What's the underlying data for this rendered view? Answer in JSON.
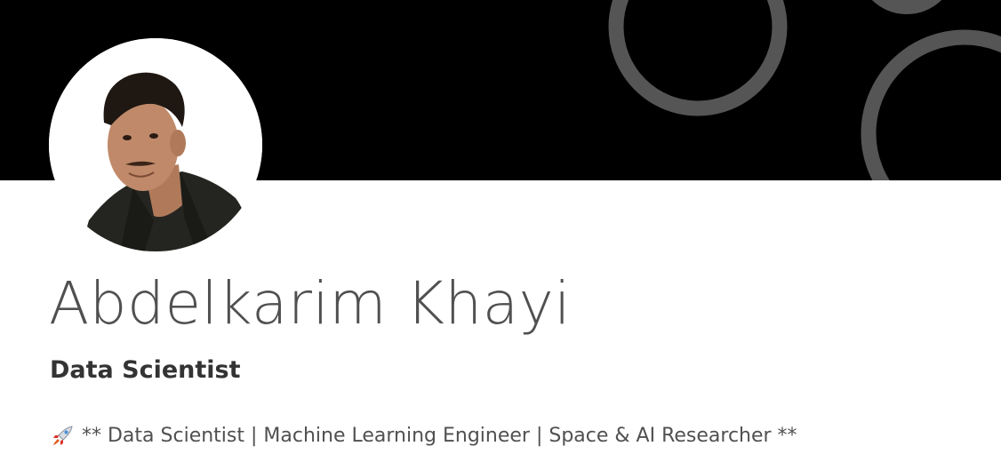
{
  "theme": {
    "banner_color": "#000000",
    "ring_color": "#555555",
    "name_color": "#505050",
    "headline_color": "#333333",
    "summary_color": "#505050"
  },
  "profile": {
    "name": "Abdelkarim Khayi",
    "headline": "Data Scientist",
    "summary_icon": "rocket-icon",
    "summary": "** Data Scientist | Machine Learning Engineer | Space & AI Researcher **"
  }
}
